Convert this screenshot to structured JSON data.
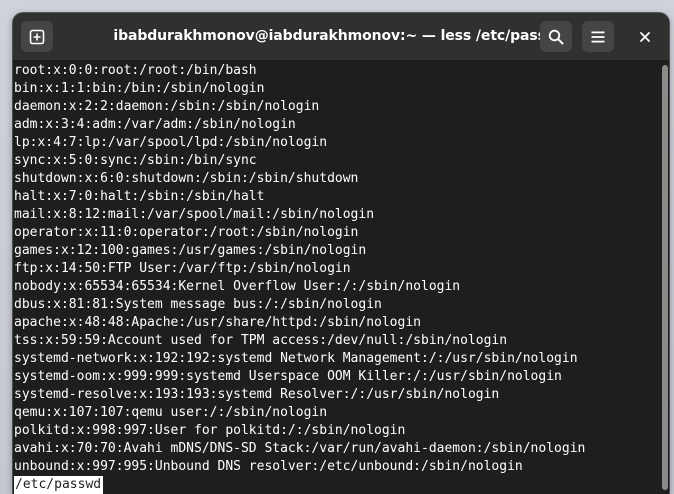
{
  "window": {
    "title": "ibabdurakhmonov@iabdurakhmonov:~ — less /etc/passwd"
  },
  "toolbar": {
    "new_tab_icon": "new-tab-icon",
    "search_icon": "search-icon",
    "menu_icon": "hamburger-menu-icon",
    "close_icon": "close-icon"
  },
  "terminal": {
    "lines": [
      "root:x:0:0:root:/root:/bin/bash",
      "bin:x:1:1:bin:/bin:/sbin/nologin",
      "daemon:x:2:2:daemon:/sbin:/sbin/nologin",
      "adm:x:3:4:adm:/var/adm:/sbin/nologin",
      "lp:x:4:7:lp:/var/spool/lpd:/sbin/nologin",
      "sync:x:5:0:sync:/sbin:/bin/sync",
      "shutdown:x:6:0:shutdown:/sbin:/sbin/shutdown",
      "halt:x:7:0:halt:/sbin:/sbin/halt",
      "mail:x:8:12:mail:/var/spool/mail:/sbin/nologin",
      "operator:x:11:0:operator:/root:/sbin/nologin",
      "games:x:12:100:games:/usr/games:/sbin/nologin",
      "ftp:x:14:50:FTP User:/var/ftp:/sbin/nologin",
      "nobody:x:65534:65534:Kernel Overflow User:/:/sbin/nologin",
      "dbus:x:81:81:System message bus:/:/sbin/nologin",
      "apache:x:48:48:Apache:/usr/share/httpd:/sbin/nologin",
      "tss:x:59:59:Account used for TPM access:/dev/null:/sbin/nologin",
      "systemd-network:x:192:192:systemd Network Management:/:/usr/sbin/nologin",
      "systemd-oom:x:999:999:systemd Userspace OOM Killer:/:/usr/sbin/nologin",
      "systemd-resolve:x:193:193:systemd Resolver:/:/usr/sbin/nologin",
      "qemu:x:107:107:qemu user:/:/sbin/nologin",
      "polkitd:x:998:997:User for polkitd:/:/sbin/nologin",
      "avahi:x:70:70:Avahi mDNS/DNS-SD Stack:/var/run/avahi-daemon:/sbin/nologin",
      "unbound:x:997:995:Unbound DNS resolver:/etc/unbound:/sbin/nologin"
    ],
    "status_line": "/etc/passwd"
  },
  "colors": {
    "terminal_bg": "#1e1e1e",
    "terminal_fg": "#ffffff",
    "headerbar_bg": "#303030",
    "status_bg": "#ffffff",
    "status_fg": "#1e1e1e"
  }
}
